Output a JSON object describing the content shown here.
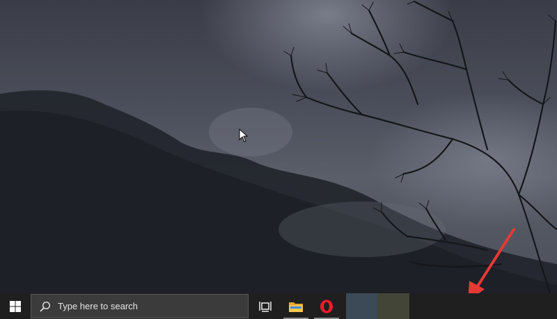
{
  "taskbar": {
    "start_icon": "windows-logo-icon",
    "search": {
      "icon": "search-icon",
      "placeholder": "Type here to search"
    },
    "task_view_icon": "task-view-icon",
    "pinned_apps": [
      {
        "name": "File Explorer",
        "icon": "folder-icon",
        "active": true
      },
      {
        "name": "Opera",
        "icon": "opera-icon",
        "active": true
      }
    ],
    "colors": {
      "background": "#1f1f1f",
      "search_background": "#3b3b3b",
      "opera_red": "#ff1b2d",
      "folder_yellow": "#f8c94a",
      "annotation_arrow": "#e53935"
    }
  }
}
